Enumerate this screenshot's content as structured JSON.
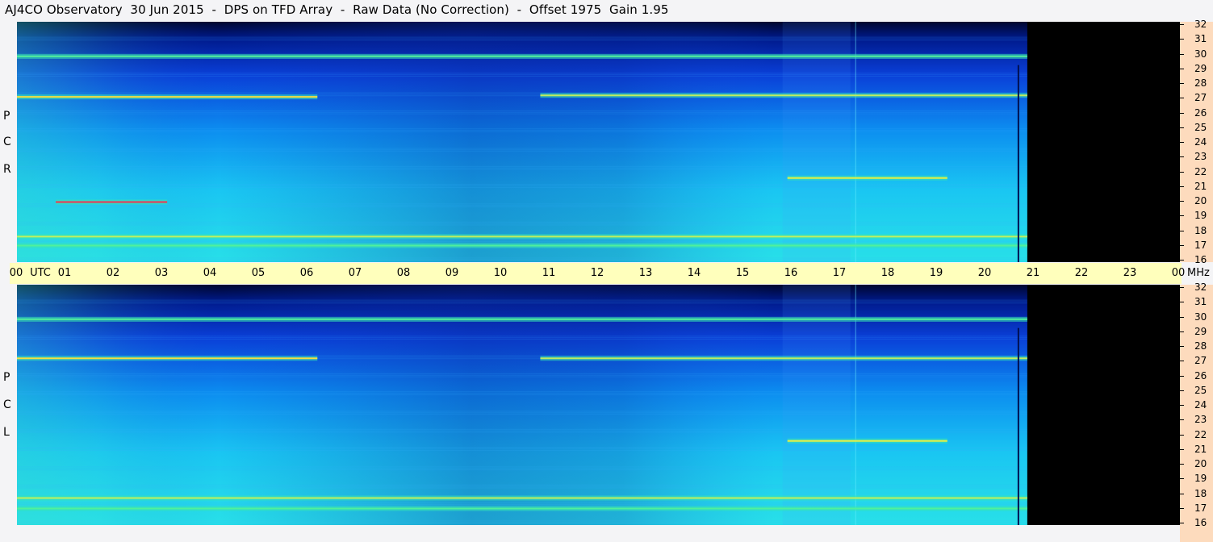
{
  "header": {
    "title": "AJ4CO Observatory  30 Jun 2015  -  DPS on TFD Array  -  Raw Data (No Correction)  -  Offset 1975  Gain 1.95"
  },
  "time_axis": {
    "labels": [
      "00",
      "01",
      "02",
      "03",
      "04",
      "05",
      "06",
      "07",
      "08",
      "09",
      "10",
      "11",
      "12",
      "13",
      "14",
      "15",
      "16",
      "17",
      "18",
      "19",
      "20",
      "21",
      "22",
      "23",
      "00"
    ],
    "unit_label": "UTC",
    "freq_unit": "MHz"
  },
  "panels": [
    {
      "id": "rcp",
      "letters": [
        "P",
        "C",
        "R"
      ]
    },
    {
      "id": "lcp",
      "letters": [
        "P",
        "C",
        "L"
      ]
    }
  ],
  "freq_axis": {
    "labels": [
      "32",
      "31",
      "30",
      "29",
      "28",
      "27",
      "26",
      "25",
      "24",
      "23",
      "22",
      "21",
      "20",
      "19",
      "18",
      "17",
      "16"
    ]
  },
  "colors": {
    "background": "#f4f4f6",
    "time_axis_bg": "#ffffbc",
    "freq_scale_bg": "#fddbbd",
    "no_data": "#000000"
  },
  "chart_data": [
    {
      "type": "heatmap",
      "name": "RCP",
      "x_label": "UTC",
      "x_range_hours": [
        0,
        24
      ],
      "y_label": "MHz",
      "y_range_mhz": [
        16,
        32
      ],
      "data_end_hour": 20.85,
      "colormap": [
        "dark-blue",
        "blue",
        "cyan",
        "green",
        "yellow",
        "red"
      ],
      "features": [
        {
          "freq_mhz": 27.0,
          "hours": [
            0,
            6.2
          ],
          "level": "yellow-red"
        },
        {
          "freq_mhz": 27.1,
          "hours": [
            10.8,
            20.85
          ],
          "level": "yellow-green"
        },
        {
          "freq_mhz": 29.7,
          "hours": [
            0,
            20.85
          ],
          "level": "green"
        },
        {
          "freq_mhz": 17.7,
          "hours": [
            0,
            20.85
          ],
          "level": "yellow-green"
        },
        {
          "freq_mhz": 17.1,
          "hours": [
            0,
            20.85
          ],
          "level": "green"
        },
        {
          "freq_mhz": 20.0,
          "hours": [
            0.8,
            3.1
          ],
          "level": "red"
        },
        {
          "freq_mhz": 21.6,
          "hours": [
            15.9,
            19.2
          ],
          "level": "yellow"
        }
      ]
    },
    {
      "type": "heatmap",
      "name": "LCP",
      "x_label": "UTC",
      "x_range_hours": [
        0,
        24
      ],
      "y_label": "MHz",
      "y_range_mhz": [
        16,
        32
      ],
      "data_end_hour": 20.85,
      "colormap": [
        "dark-blue",
        "blue",
        "cyan",
        "green",
        "yellow",
        "red"
      ],
      "features": [
        {
          "freq_mhz": 27.1,
          "hours": [
            0,
            6.2
          ],
          "level": "yellow-red"
        },
        {
          "freq_mhz": 27.1,
          "hours": [
            10.8,
            20.85
          ],
          "level": "yellow-green"
        },
        {
          "freq_mhz": 29.7,
          "hours": [
            0,
            20.85
          ],
          "level": "green"
        },
        {
          "freq_mhz": 17.8,
          "hours": [
            0,
            20.85
          ],
          "level": "yellow-green"
        },
        {
          "freq_mhz": 17.1,
          "hours": [
            0,
            20.85
          ],
          "level": "green"
        },
        {
          "freq_mhz": 21.6,
          "hours": [
            15.9,
            19.2
          ],
          "level": "yellow"
        }
      ]
    }
  ]
}
